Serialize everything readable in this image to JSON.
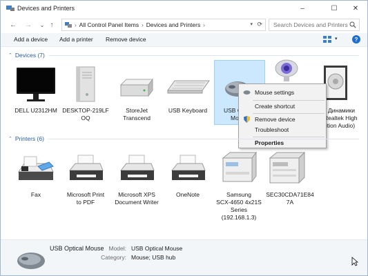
{
  "window": {
    "title": "Devices and Printers",
    "controls": {
      "minimize": "–",
      "maximize": "☐",
      "close": "✕"
    }
  },
  "address": {
    "crumbs": [
      "All Control Panel Items",
      "Devices and Printers"
    ],
    "search_placeholder": "Search Devices and Printers"
  },
  "toolbar": {
    "add_device": "Add a device",
    "add_printer": "Add a printer",
    "remove_device": "Remove device",
    "help": "?"
  },
  "sections": {
    "devices_label": "Devices (7)",
    "printers_label": "Printers (6)"
  },
  "devices": [
    {
      "name": "DELL U2312HM",
      "lines": [
        "DELL U2312HM"
      ],
      "icon": "monitor-icon"
    },
    {
      "name": "DESKTOP-219LF OQ",
      "lines": [
        "DESKTOP-219LF",
        "OQ"
      ],
      "icon": "computer-icon"
    },
    {
      "name": "StoreJet Transcend",
      "lines": [
        "StoreJet",
        "Transcend"
      ],
      "icon": "drive-icon"
    },
    {
      "name": "USB Keyboard",
      "lines": [
        "USB Keyboard"
      ],
      "icon": "keyboard-icon"
    },
    {
      "name": "USB Optical Mouse",
      "lines": [
        "USB O",
        "Mo"
      ],
      "icon": "mouse-icon"
    },
    {
      "name": "webcam",
      "lines": [
        ""
      ],
      "icon": "webcam-icon"
    },
    {
      "name": "Динамики (Realtek High Definition Audio)",
      "lines": [
        "Динамики",
        "Realtek High",
        "finition Audio)"
      ],
      "icon": "speaker-icon"
    }
  ],
  "printers": [
    {
      "lines": [
        "Fax"
      ],
      "icon": "fax-icon"
    },
    {
      "lines": [
        "Microsoft Print",
        "to PDF"
      ],
      "icon": "printer-icon"
    },
    {
      "lines": [
        "Microsoft XPS",
        "Document Writer"
      ],
      "icon": "printer-icon"
    },
    {
      "lines": [
        "OneNote"
      ],
      "icon": "printer-icon"
    },
    {
      "lines": [
        "Samsung",
        "SCX-4650 4x21S",
        "Series",
        "(192.168.1.3)"
      ],
      "icon": "mfp-printer-icon"
    },
    {
      "lines": [
        "SEC30CDA71E84",
        "7A"
      ],
      "icon": "mfp-printer-icon"
    }
  ],
  "context_menu": {
    "mouse_settings": "Mouse settings",
    "create_shortcut": "Create shortcut",
    "remove_device": "Remove device",
    "troubleshoot": "Troubleshoot",
    "properties": "Properties"
  },
  "details": {
    "name": "USB Optical Mouse",
    "model_label": "Model:",
    "model_value": "USB Optical Mouse",
    "category_label": "Category:",
    "category_value": "Mouse; USB hub"
  },
  "colors": {
    "selection_bg": "#cce8ff",
    "section_label": "#2a5aa0",
    "help_blue": "#1a6fd1"
  }
}
